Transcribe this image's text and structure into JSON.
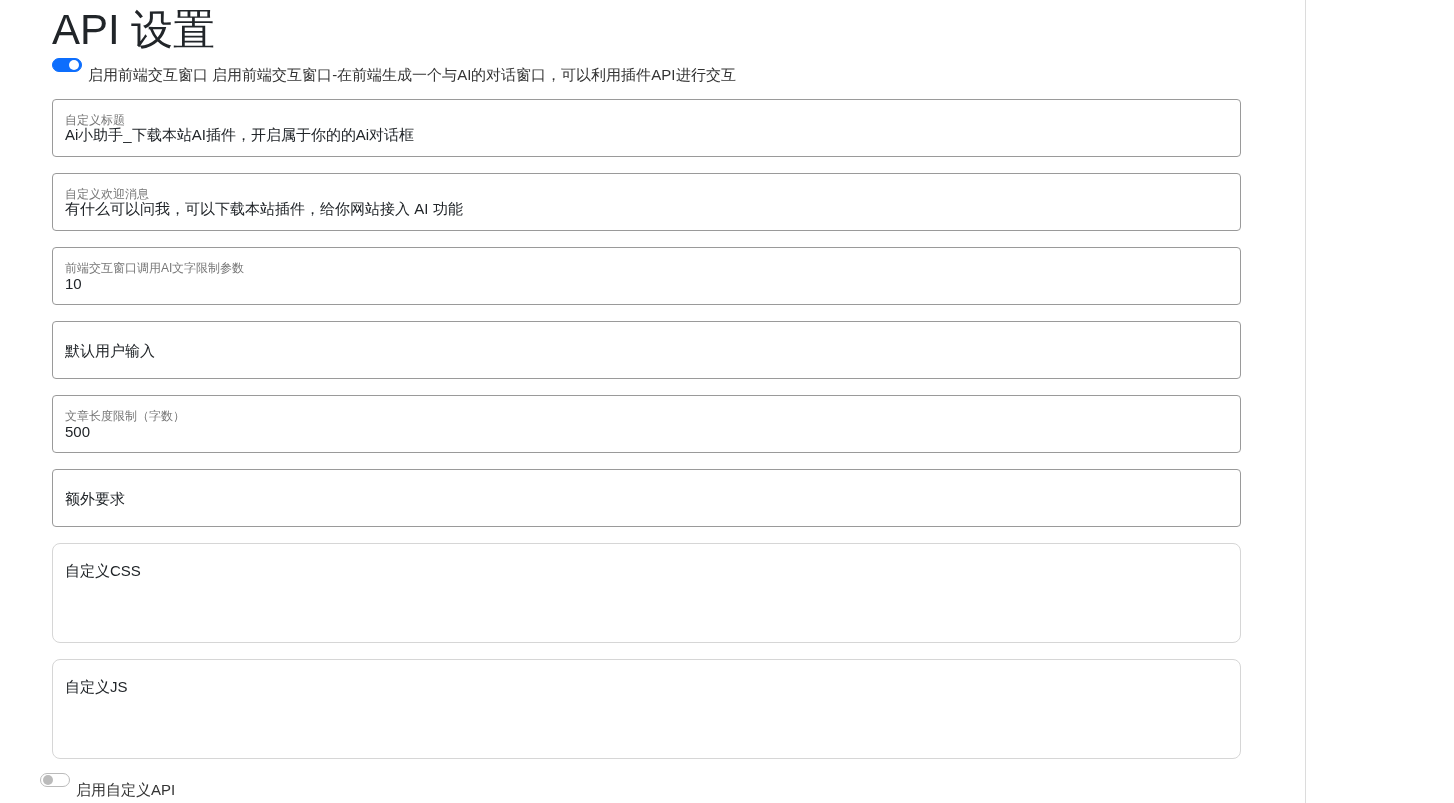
{
  "title": "API 设置",
  "frontend_switch": {
    "on": true,
    "label": "启用前端交互窗口",
    "description": "启用前端交互窗口-在前端生成一个与AI的对话窗口，可以利用插件API进行交互"
  },
  "fields": [
    {
      "kind": "floating",
      "label": "自定义标题",
      "value": "Ai小助手_下载本站AI插件，开启属于你的的Ai对话框"
    },
    {
      "kind": "floating",
      "label": "自定义欢迎消息",
      "value": "有什么可以问我，可以下载本站插件，给你网站接入 AI 功能"
    },
    {
      "kind": "floating",
      "label": "前端交互窗口调用AI文字限制参数",
      "value": "10"
    },
    {
      "kind": "floating",
      "placeholder": "默认用户输入"
    },
    {
      "kind": "floating",
      "label": "文章长度限制（字数）",
      "value": "500"
    },
    {
      "kind": "floating",
      "placeholder": "额外要求"
    },
    {
      "kind": "textarea",
      "placeholder": "自定义CSS"
    },
    {
      "kind": "textarea",
      "placeholder": "自定义JS"
    }
  ],
  "custom_api_switch": {
    "on": false,
    "label": "启用自定义API"
  }
}
